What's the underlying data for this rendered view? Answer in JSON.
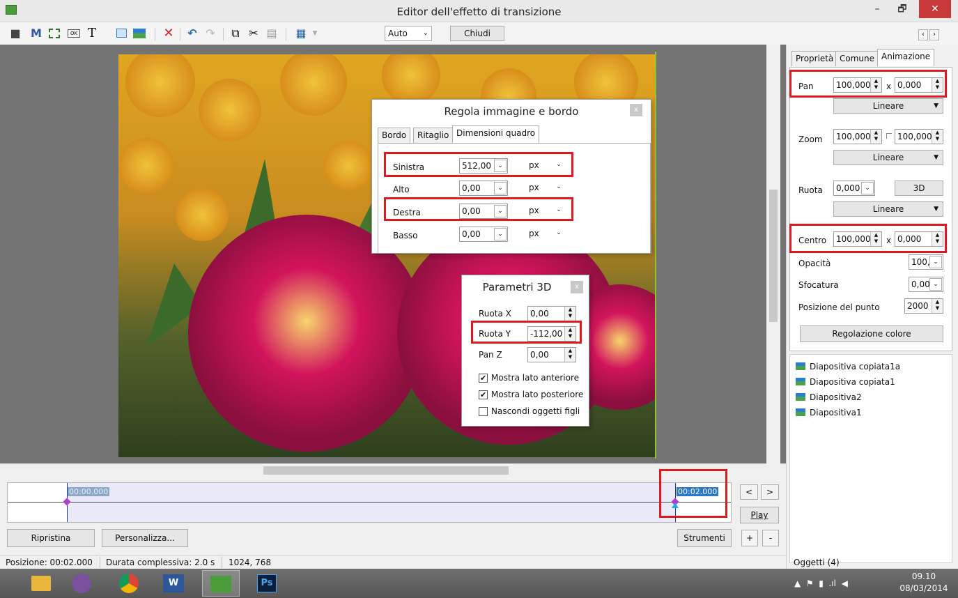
{
  "window": {
    "title": "Editor dell'effetto di transizione",
    "minimize": "–",
    "maximize": "🗗",
    "close": "✕"
  },
  "toolbar": {
    "zoom_value": "Auto",
    "close_label": "Chiudi",
    "nav_left": "‹",
    "nav_right": "›"
  },
  "dialog_image": {
    "title": "Regola immagine e bordo",
    "close": "x",
    "tabs": [
      "Bordo",
      "Ritaglio",
      "Dimensioni quadro"
    ],
    "fields": [
      {
        "label": "Sinistra",
        "value": "512,00",
        "unit": "px"
      },
      {
        "label": "Alto",
        "value": "0,00",
        "unit": "px"
      },
      {
        "label": "Destra",
        "value": "0,00",
        "unit": "px"
      },
      {
        "label": "Basso",
        "value": "0,00",
        "unit": "px"
      }
    ]
  },
  "dialog_3d": {
    "title": "Parametri 3D",
    "close": "x",
    "fields": [
      {
        "label": "Ruota X",
        "value": "0,00"
      },
      {
        "label": "Ruota Y",
        "value": "-112,00"
      },
      {
        "label": "Pan Z",
        "value": "0,00"
      }
    ],
    "checkboxes": [
      {
        "label": "Mostra lato anteriore",
        "checked": true
      },
      {
        "label": "Mostra lato posteriore",
        "checked": true
      },
      {
        "label": "Nascondi oggetti figli",
        "checked": false
      }
    ]
  },
  "right_panel": {
    "tabs": [
      "Proprietà",
      "Comune",
      "Animazione"
    ],
    "pan": {
      "label": "Pan",
      "x": "100,000",
      "sep": "x",
      "y": "0,000",
      "mode": "Lineare"
    },
    "zoom": {
      "label": "Zoom",
      "x": "100,000",
      "y": "100,000",
      "mode": "Lineare"
    },
    "rotate": {
      "label": "Ruota",
      "value": "0,000",
      "button": "3D",
      "mode": "Lineare"
    },
    "center": {
      "label": "Centro",
      "x": "100,000",
      "sep": "x",
      "y": "0,000"
    },
    "opacity": {
      "label": "Opacità",
      "value": "100,0"
    },
    "blur": {
      "label": "Sfocatura",
      "value": "0,00"
    },
    "point_pos": {
      "label": "Posizione del punto",
      "value": "2000"
    },
    "color_button": "Regolazione colore",
    "objects": [
      "Diapositiva copiata1a",
      "Diapositiva copiata1",
      "Diapositiva2",
      "Diapositiva1"
    ],
    "objects_count": "Oggetti (4)"
  },
  "timeline": {
    "start": "00:00.000",
    "end": "00:02.000",
    "prev": "<",
    "next": ">",
    "play": "Play",
    "plus": "+",
    "minus": "-"
  },
  "bottom_buttons": {
    "reset": "Ripristina",
    "customize": "Personalizza...",
    "tools": "Strumenti"
  },
  "status": {
    "position": "Posizione: 00:02.000",
    "duration": "Durata complessiva: 2.0 s",
    "size": "1024, 768"
  },
  "taskbar": {
    "time": "09.10",
    "date": "08/03/2014"
  }
}
